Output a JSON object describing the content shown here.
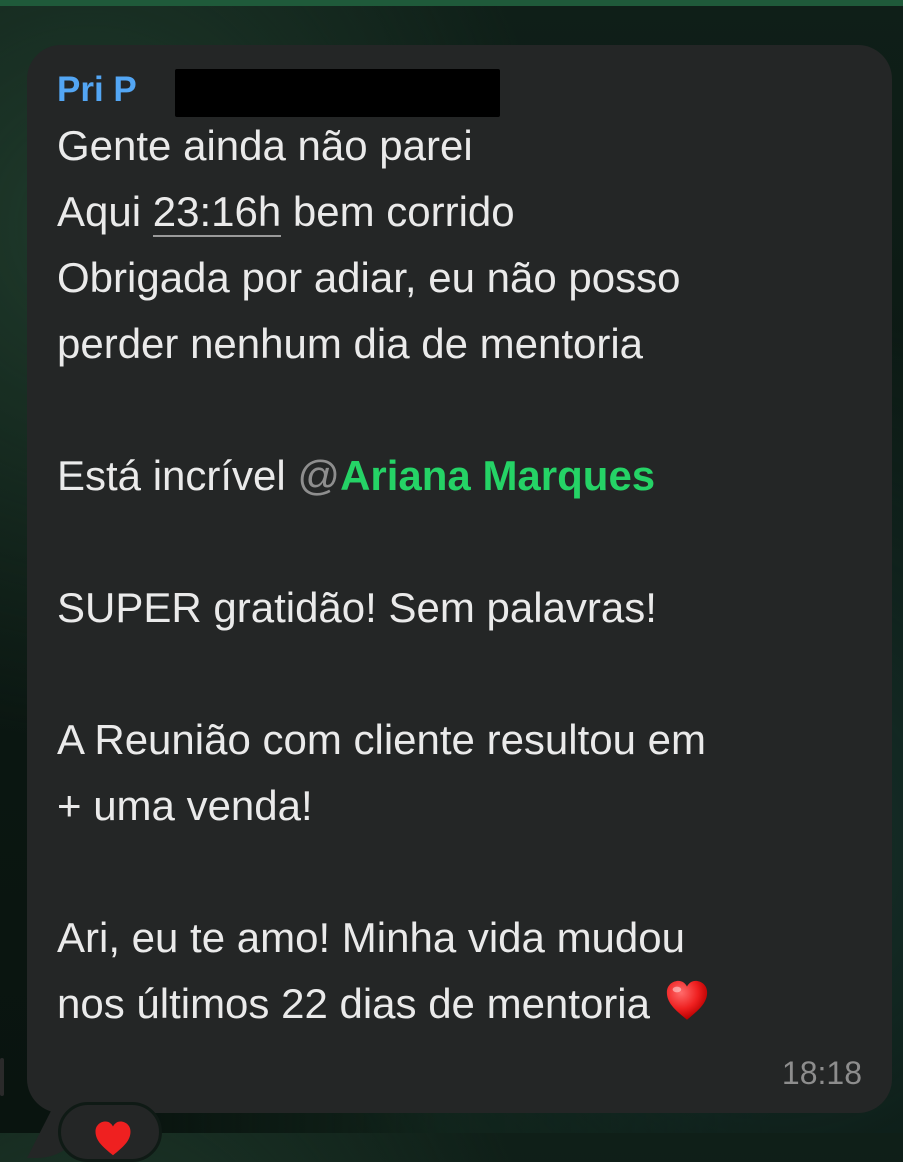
{
  "message": {
    "sender": "Pri P",
    "lines": [
      "Gente ainda não parei",
      "Aqui ",
      "23:16h",
      " bem corrido",
      "Obrigada por adiar, eu não posso",
      "perder nenhum dia de mentoria",
      "Está incrível ",
      "@",
      "Ariana Marques",
      "SUPER gratidão! Sem palavras!",
      "A Reunião com cliente resultou em",
      "+ uma venda!",
      "Ari, eu te amo! Minha vida mudou",
      "nos últimos 22 dias de mentoria"
    ],
    "timestamp": "18:18"
  },
  "icons": {
    "heart": "red-heart-emoji",
    "reaction": "red-heart-reaction"
  },
  "colors": {
    "bubble": "#242626",
    "sender": "#53a6f4",
    "mention": "#25d366",
    "text": "#eaeaea"
  }
}
